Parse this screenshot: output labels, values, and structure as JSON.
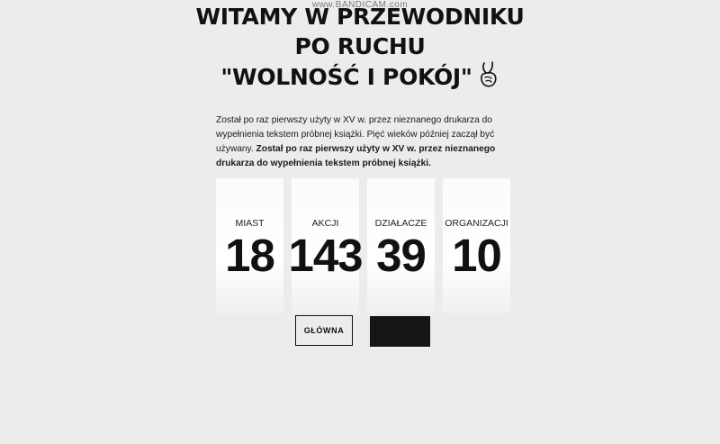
{
  "watermark": "www.BANDICAM.com",
  "hero": {
    "title_line1": "WITAMY W PRZEWODNIKU",
    "title_line2": "PO RUCHU",
    "title_line3": "\"WOLNOŚĆ I POKÓJ\"",
    "icon": "peace-hand-icon"
  },
  "intro": {
    "normal": "Został po raz pierwszy użyty w XV w. przez nieznanego drukarza do wypełnienia tekstem próbnej książki. Pięć wieków później zaczął być używany. ",
    "bold": "Został po raz pierwszy użyty w XV w. przez nieznanego drukarza do wypełnienia tekstem próbnej książki."
  },
  "stats": [
    {
      "label": "MIAST",
      "value": "18"
    },
    {
      "label": "AKCJI",
      "value": "143"
    },
    {
      "label": "DZIAŁACZE",
      "value": "39"
    },
    {
      "label": "ORGANIZACJI",
      "value": "10"
    }
  ],
  "buttons": {
    "main_label": "GŁÓWNA"
  }
}
